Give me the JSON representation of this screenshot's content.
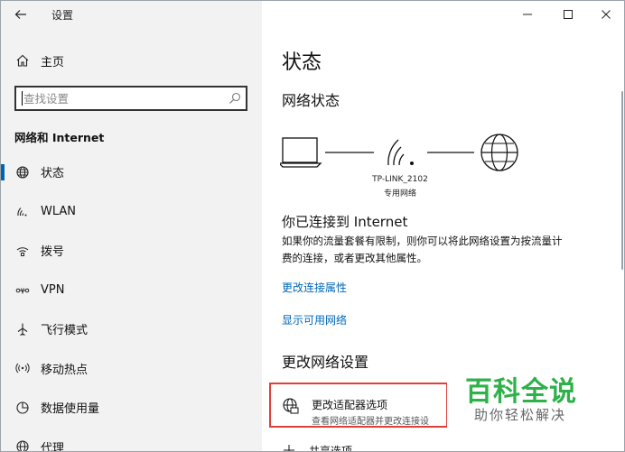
{
  "window": {
    "title": "设置",
    "controls": [
      "minimize",
      "maximize",
      "close"
    ]
  },
  "sidebar": {
    "home_label": "主页",
    "search_placeholder": "查找设置",
    "section_title": "网络和 Internet",
    "items": [
      {
        "label": "状态",
        "icon": "home-globe-icon",
        "active": true
      },
      {
        "label": "WLAN",
        "icon": "wifi-icon",
        "active": false
      },
      {
        "label": "拨号",
        "icon": "dialup-icon",
        "active": false
      },
      {
        "label": "VPN",
        "icon": "vpn-icon",
        "active": false
      },
      {
        "label": "飞行模式",
        "icon": "airplane-icon",
        "active": false
      },
      {
        "label": "移动热点",
        "icon": "hotspot-icon",
        "active": false
      },
      {
        "label": "数据使用量",
        "icon": "data-usage-icon",
        "active": false
      },
      {
        "label": "代理",
        "icon": "globe-icon",
        "active": false
      }
    ]
  },
  "main": {
    "page_title": "状态",
    "network_status_heading": "网络状态",
    "network_name": "TP-LINK_2102",
    "network_type": "专用网络",
    "connected_heading": "你已连接到 Internet",
    "connected_desc_line1": "如果你的流量套餐有限制，则你可以将此网络设置为按流量计",
    "connected_desc_line2": "费的连接，或者更改其他属性。",
    "link_change_properties": "更改连接属性",
    "link_show_networks": "显示可用网络",
    "change_settings_heading": "更改网络设置",
    "adapter_option_title": "更改适配器选项",
    "adapter_option_sub": "查看网络适配器并更改连接设",
    "sharing_option_title": "共享选项"
  },
  "watermark": {
    "big": "百科全说",
    "small": "助你轻松解决"
  },
  "colors": {
    "accent": "#0063b1",
    "link": "#0067b8",
    "highlight_border": "#e0403c",
    "watermark_green": "#2fb14a",
    "sidebar_bg": "#f2f2f2"
  }
}
